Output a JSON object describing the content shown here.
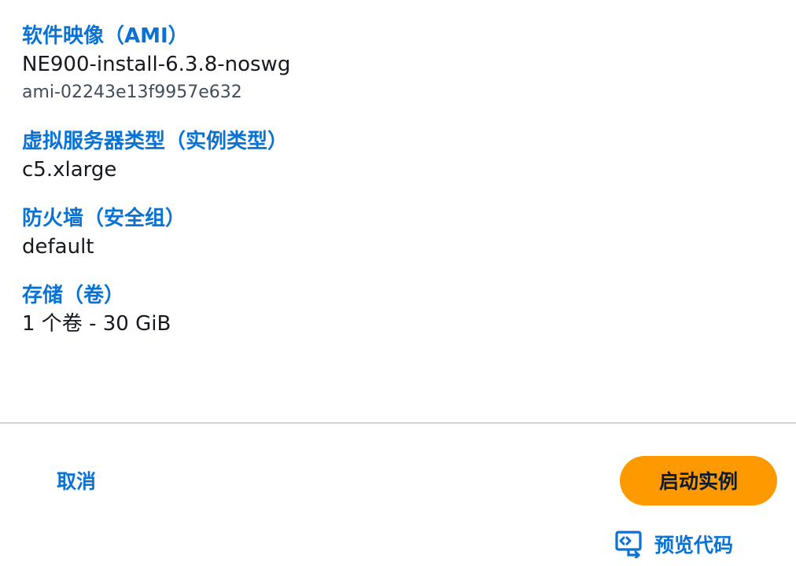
{
  "sections": {
    "ami": {
      "label": "软件映像（AMI）",
      "value": "NE900-install-6.3.8-noswg",
      "sub": "ami-02243e13f9957e632"
    },
    "instance_type": {
      "label": "虚拟服务器类型（实例类型）",
      "value": "c5.xlarge"
    },
    "firewall": {
      "label": "防火墙（安全组）",
      "value": "default"
    },
    "storage": {
      "label": "存储（卷）",
      "value": "1 个卷 - 30 GiB"
    }
  },
  "actions": {
    "cancel_label": "取消",
    "launch_label": "启动实例",
    "preview_label": "预览代码",
    "preview_icon": "code-preview-icon"
  },
  "colors": {
    "link": "#0972d3",
    "primary_button": "#ff9900",
    "text": "#16191f",
    "divider": "#d1d5db"
  }
}
